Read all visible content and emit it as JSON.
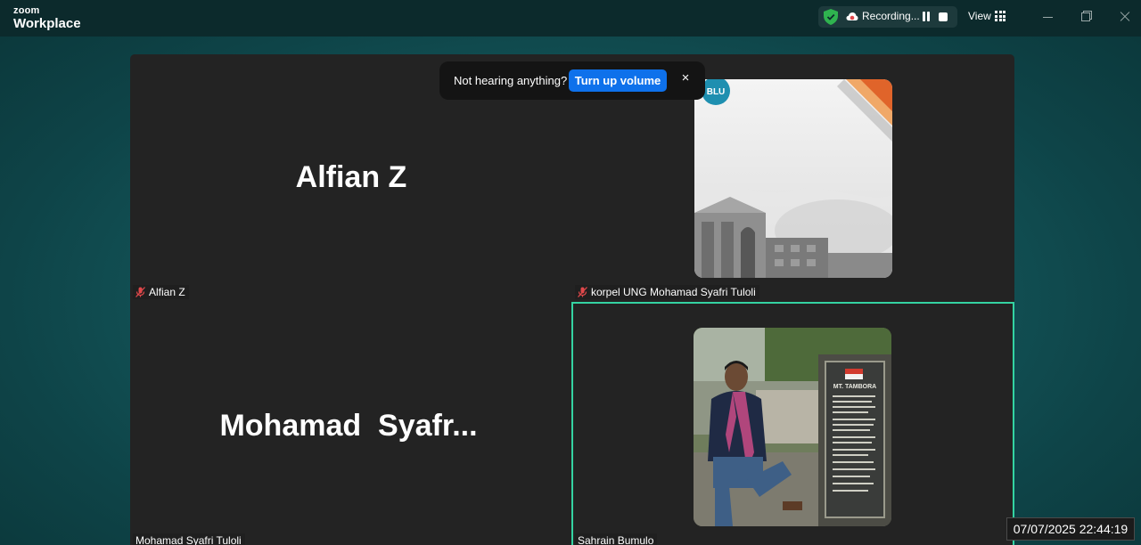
{
  "app": {
    "logo_line1": "zoom",
    "logo_line2": "Workplace"
  },
  "toolbar": {
    "recording_label": "Recording...",
    "view_label": "View",
    "shield_color": "#2fb34f",
    "recording_color": "#e0484b"
  },
  "toast": {
    "message": "Not hearing anything?",
    "action_label": "Turn up volume",
    "close_label": "×"
  },
  "participants": [
    {
      "display_name": "Alfian Z",
      "name_tag": "Alfian Z",
      "muted": true,
      "video": false
    },
    {
      "display_name": "",
      "name_tag": "korpel UNG Mohamad Syafri Tuloli",
      "muted": true,
      "video": "profile-picture",
      "badge_text": "BLU"
    },
    {
      "display_name": "Mohamad  Syafr...",
      "name_tag": "Mohamad Syafri Tuloli",
      "muted": false,
      "video": false
    },
    {
      "display_name": "",
      "name_tag": "Sahrain Bumulo",
      "muted": false,
      "video": "profile-picture",
      "active_speaker": true,
      "sign_text": "MT. TAMBORA"
    }
  ],
  "timestamp": "07/07/2025 22:44:19",
  "colors": {
    "active_speaker_border": "#34d3a2",
    "accent_button": "#0e71eb",
    "muted_icon": "#e0484b"
  }
}
